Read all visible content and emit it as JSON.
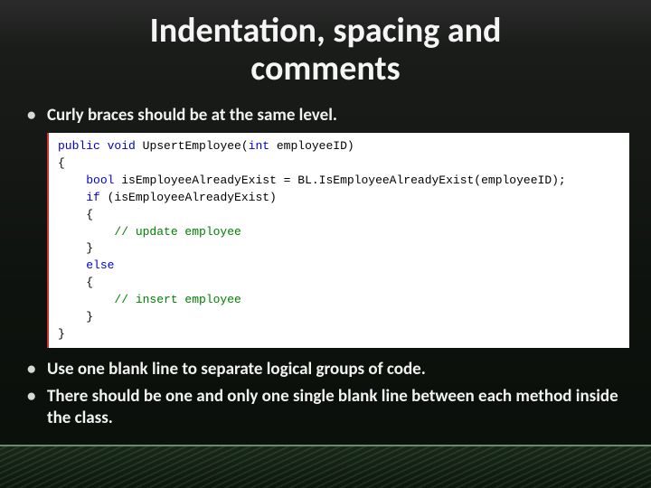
{
  "title_line1": "Indentation, spacing and",
  "title_line2": "comments",
  "bullets": {
    "b1": "Curly braces should be at the same level.",
    "b2": "Use one blank line to separate logical groups of code.",
    "b3": "There should be one and only one single blank line between each method inside the class."
  },
  "code": {
    "l1_kw1": "public",
    "l1_kw2": "void",
    "l1_rest": " UpsertEmployee(",
    "l1_kw3": "int",
    "l1_rest2": " employeeID)",
    "l2": "{",
    "l3_kw": "bool",
    "l3_rest": " isEmployeeAlreadyExist = BL.IsEmployeeAlreadyExist(employeeID);",
    "l4_kw": "if",
    "l4_rest": " (isEmployeeAlreadyExist)",
    "l5": "    {",
    "l6_cm": "        // update employee",
    "l7": "    }",
    "l8_kw": "else",
    "l9": "    {",
    "l10_cm": "        // insert employee",
    "l11": "    }",
    "l12": "}"
  }
}
